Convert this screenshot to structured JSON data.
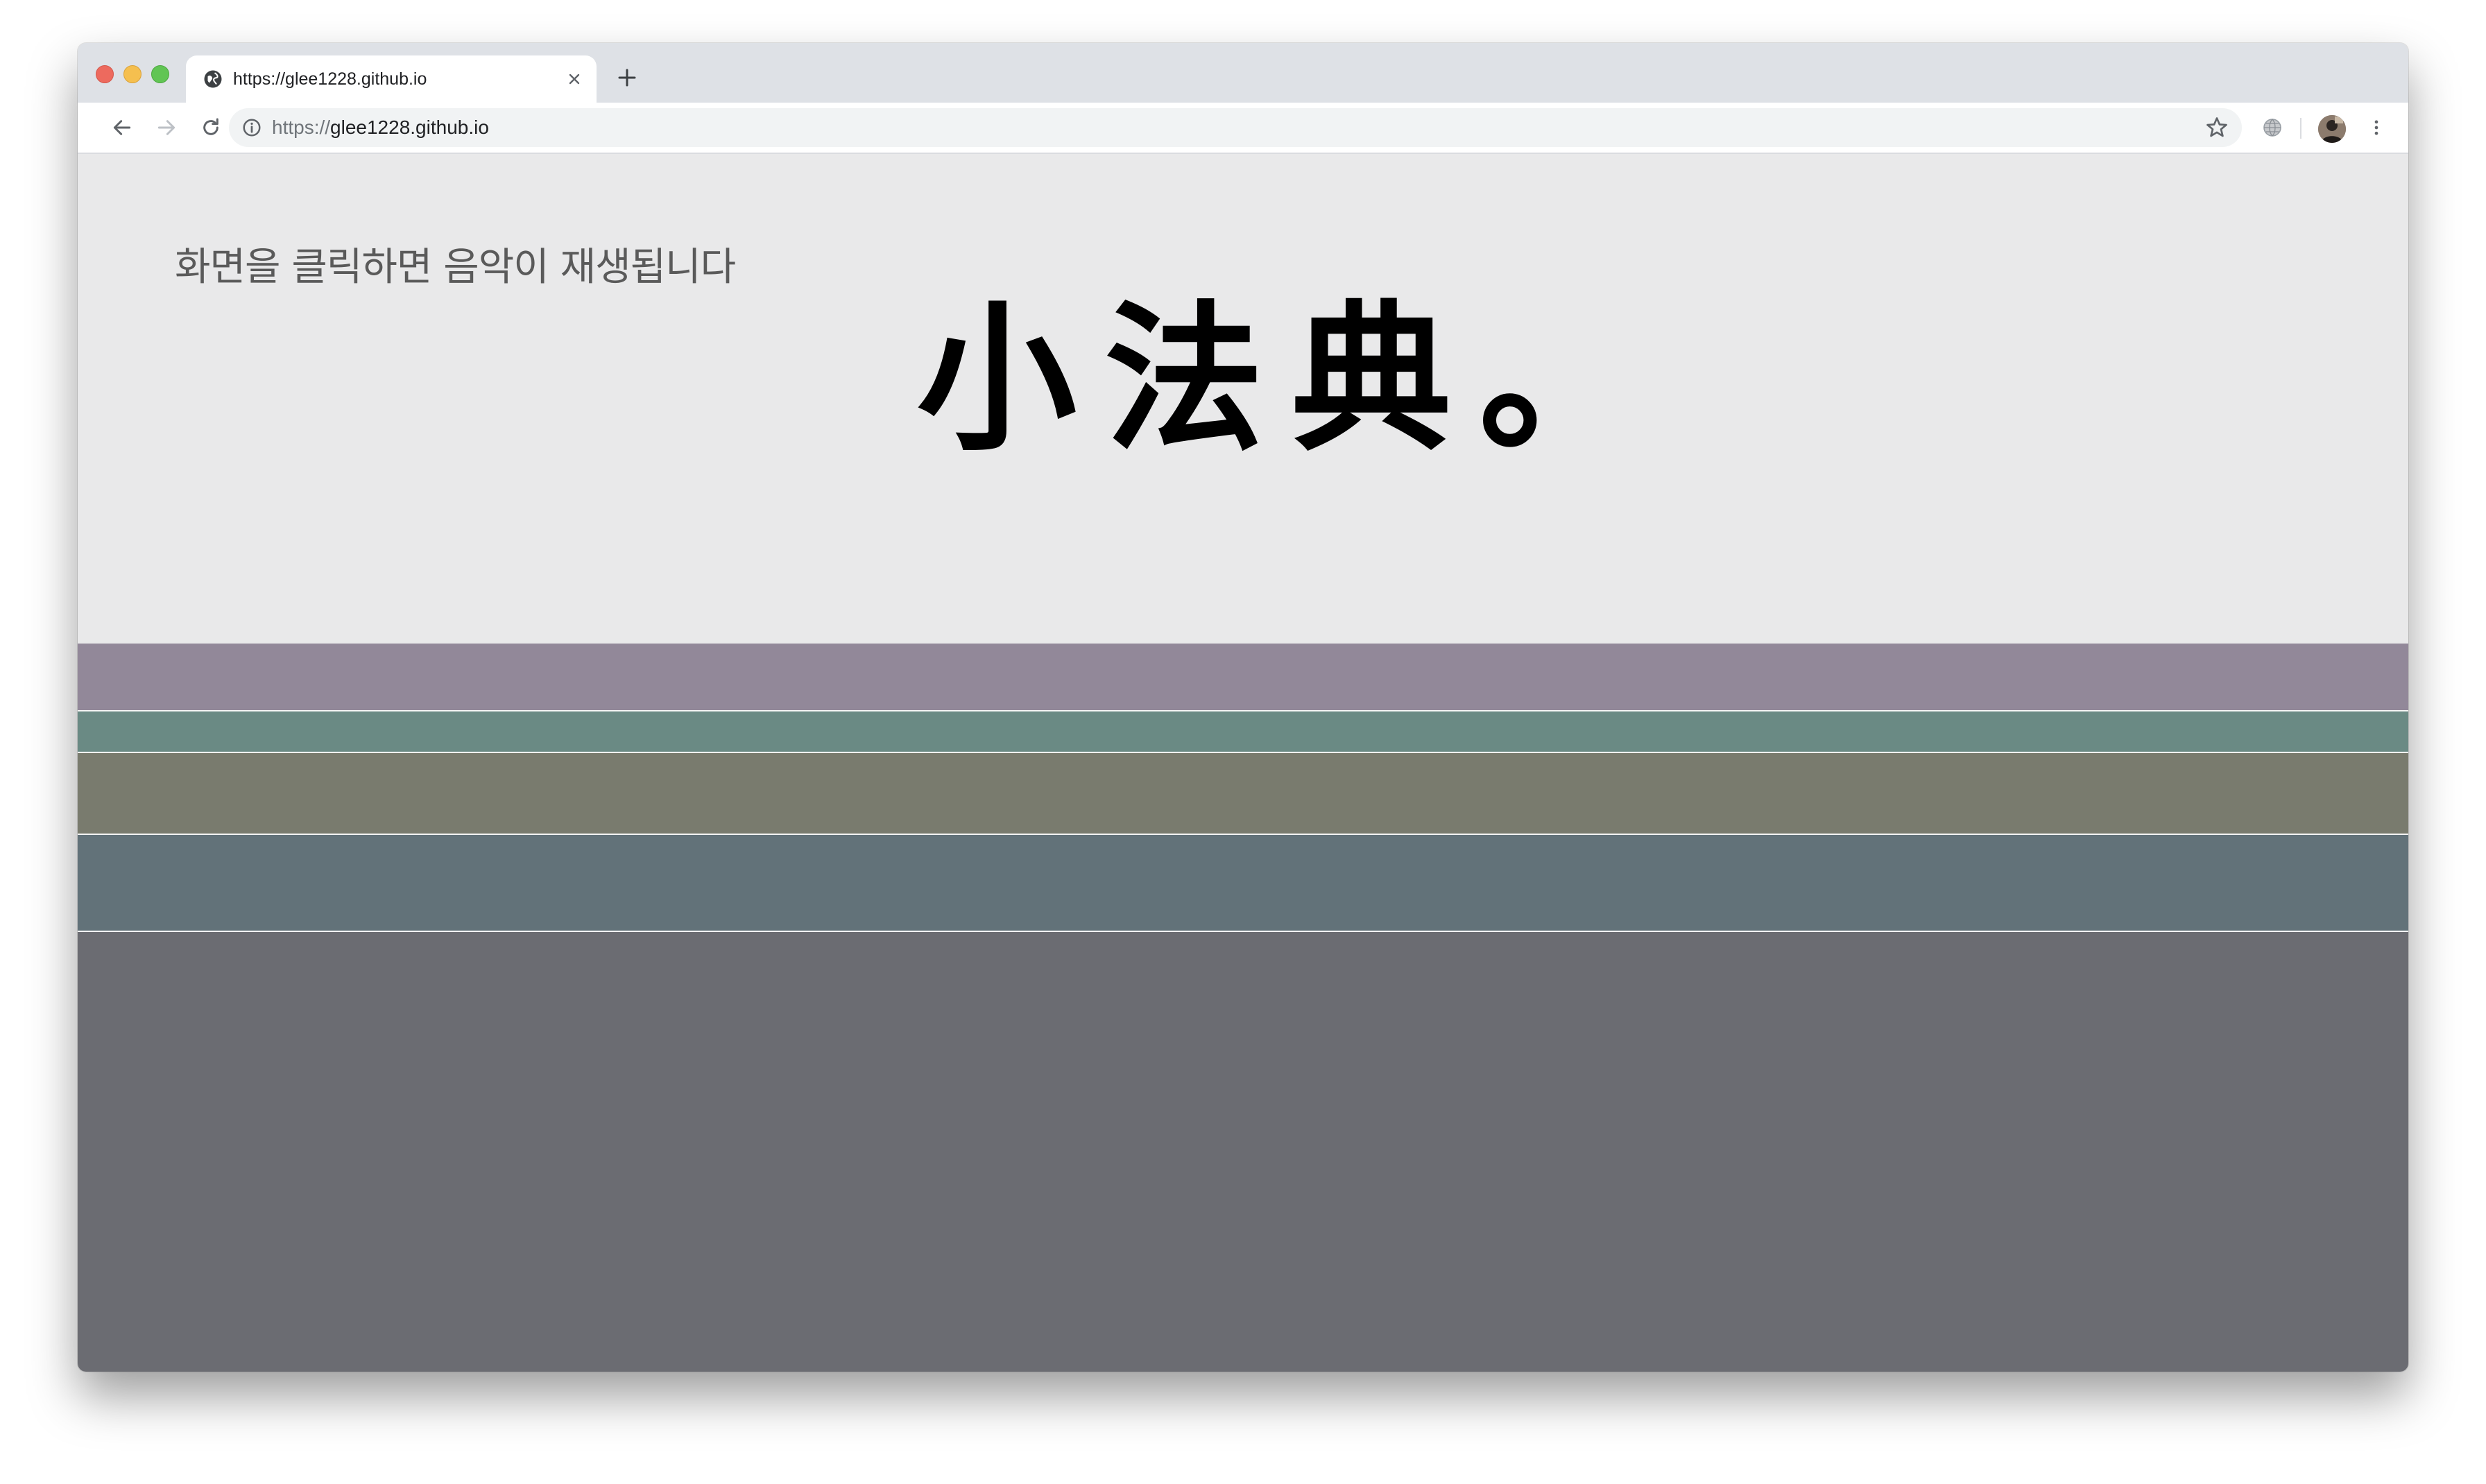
{
  "browser": {
    "tab": {
      "title": "https://glee1228.github.io"
    },
    "address": {
      "scheme": "https://",
      "host": "glee1228.github.io"
    }
  },
  "page": {
    "notice": "화면을 클릭하면 음악이 재생됩니다",
    "brand": "小法典。",
    "bands": [
      {
        "color": "#928899"
      },
      {
        "color": "#6a8a84"
      },
      {
        "color": "#797b6e"
      },
      {
        "color": "#627279"
      },
      {
        "color": "#6b6c72"
      }
    ]
  },
  "icons": {
    "favicon": "globe-icon",
    "tab_close": "close-icon",
    "new_tab": "plus-icon",
    "back": "arrow-left-icon",
    "forward": "arrow-right-icon",
    "reload": "reload-icon",
    "site_info": "info-icon",
    "bookmark": "star-icon",
    "extension": "globe-extension-icon",
    "profile": "avatar",
    "menu": "kebab-menu-icon"
  }
}
